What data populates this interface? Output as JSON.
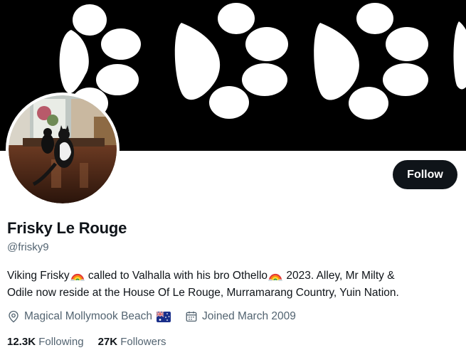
{
  "banner": {
    "background": "#000000",
    "motif": "paw-print-pattern"
  },
  "avatar": {
    "description_icon": "cat-photo-avatar"
  },
  "follow_button": {
    "label": "Follow",
    "background": "#0f1419",
    "color": "#ffffff"
  },
  "profile": {
    "display_name": "Frisky Le Rouge",
    "handle": "@frisky9",
    "bio": {
      "part1": "Viking Frisky",
      "part2": " called to Valhalla with his bro Othello",
      "part3": " 2023. Alley, Mr Milty &",
      "part4": "Odile now reside at the House Of Le Rouge, Murramarang Country, Yuin Nation."
    },
    "location": "Magical Mollymook Beach",
    "location_icon": "location-pin-icon",
    "location_flag_icon": "australia-flag-icon",
    "joined": "Joined March 2009",
    "joined_icon": "calendar-icon"
  },
  "stats": {
    "following_count": "12.3K",
    "following_label": " Following",
    "followers_count": "27K",
    "followers_label": " Followers"
  },
  "colors": {
    "primary_text": "#0f1419",
    "secondary_text": "#536471"
  }
}
